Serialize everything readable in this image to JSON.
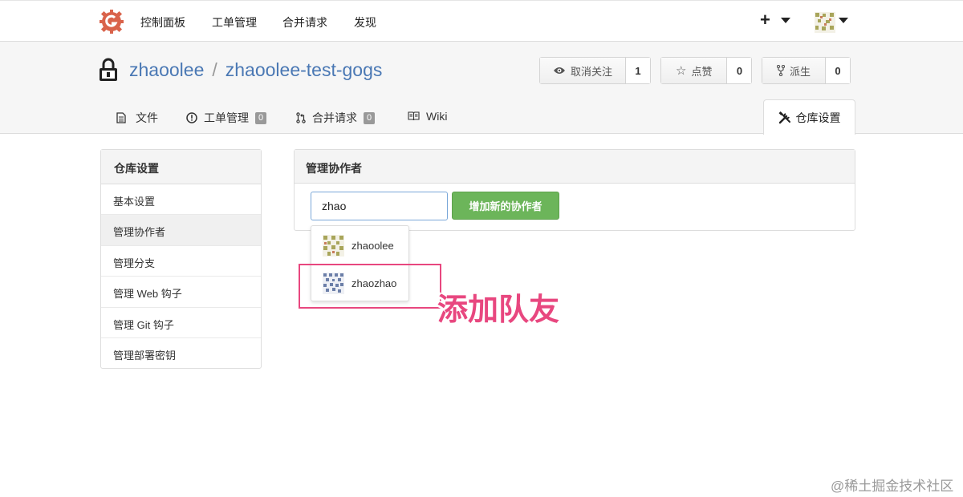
{
  "topnav": {
    "items": [
      "控制面板",
      "工单管理",
      "合并请求",
      "发现"
    ],
    "plus": "+"
  },
  "repo": {
    "owner": "zhaoolee",
    "separator": "/",
    "name": "zhaoolee-test-gogs",
    "watch": {
      "label": "取消关注",
      "count": "1"
    },
    "star": {
      "label": "点赞",
      "count": "0"
    },
    "fork": {
      "label": "派生",
      "count": "0"
    }
  },
  "tabs": {
    "files": "文件",
    "issues": {
      "label": "工单管理",
      "count": "0"
    },
    "pulls": {
      "label": "合并请求",
      "count": "0"
    },
    "wiki": "Wiki",
    "settings": "仓库设置"
  },
  "sidebar": {
    "title": "仓库设置",
    "items": [
      "基本设置",
      "管理协作者",
      "管理分支",
      "管理 Web 钩子",
      "管理 Git 钩子",
      "管理部署密钥"
    ],
    "active_index": 1
  },
  "panel": {
    "title": "管理协作者",
    "input_value": "zhao",
    "add_button": "增加新的协作者"
  },
  "suggestions": [
    "zhaoolee",
    "zhaozhao"
  ],
  "annotation": "添加队友",
  "watermark": "@稀土掘金技术社区",
  "colors": {
    "accent_link": "#4a78b4",
    "add_button": "#6cb55a",
    "annotation": "#e8477f"
  }
}
